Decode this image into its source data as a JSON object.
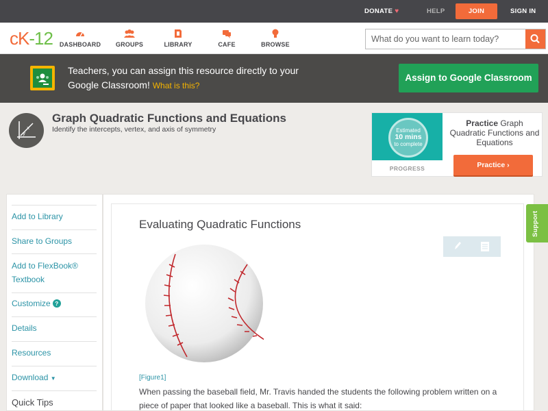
{
  "topbar": {
    "donate": "DONATE",
    "help": "HELP",
    "join": "JOIN",
    "signin": "SIGN IN"
  },
  "brand": {
    "logo_ck": "cK",
    "logo_num": "-12",
    "accent_color": "#f26b3a",
    "green_color": "#6ebf49"
  },
  "nav": {
    "items": [
      {
        "label": "DASHBOARD",
        "icon": "dashboard-icon"
      },
      {
        "label": "GROUPS",
        "icon": "groups-icon"
      },
      {
        "label": "LIBRARY",
        "icon": "library-icon"
      },
      {
        "label": "CAFE",
        "icon": "cafe-icon"
      },
      {
        "label": "BROWSE",
        "icon": "browse-icon"
      }
    ],
    "search_placeholder": "What do you want to learn today?"
  },
  "classroom": {
    "text": "Teachers, you can assign this resource directly to your Google Classroom!",
    "link": "What is this?",
    "button": "Assign to Google Classroom"
  },
  "concept": {
    "title": "Graph Quadratic Functions and Equations",
    "subtitle": "Identify the intercepts, vertex, and axis of symmetry"
  },
  "practice": {
    "estimated": "Estimated",
    "mins": "10 mins",
    "complete": "to complete",
    "progress_label": "PROGRESS",
    "title_bold": "Practice",
    "title_rest": " Graph Quadratic Functions and Equations",
    "button": "Practice"
  },
  "sidebar": {
    "items": [
      {
        "label": "Add to Library"
      },
      {
        "label": "Share to Groups"
      },
      {
        "label": "Add to FlexBook® Textbook"
      },
      {
        "label": "Customize"
      },
      {
        "label": "Details"
      },
      {
        "label": "Resources"
      },
      {
        "label": "Download"
      }
    ],
    "quick_tips": "Quick Tips"
  },
  "article": {
    "title": "Evaluating Quadratic Functions",
    "figure_label": "[Figure1]",
    "paragraph": "When passing the baseball field, Mr. Travis handed the students the following problem written on a piece of paper that looked like a baseball. This is what it said:"
  },
  "support": {
    "label": "Support"
  }
}
